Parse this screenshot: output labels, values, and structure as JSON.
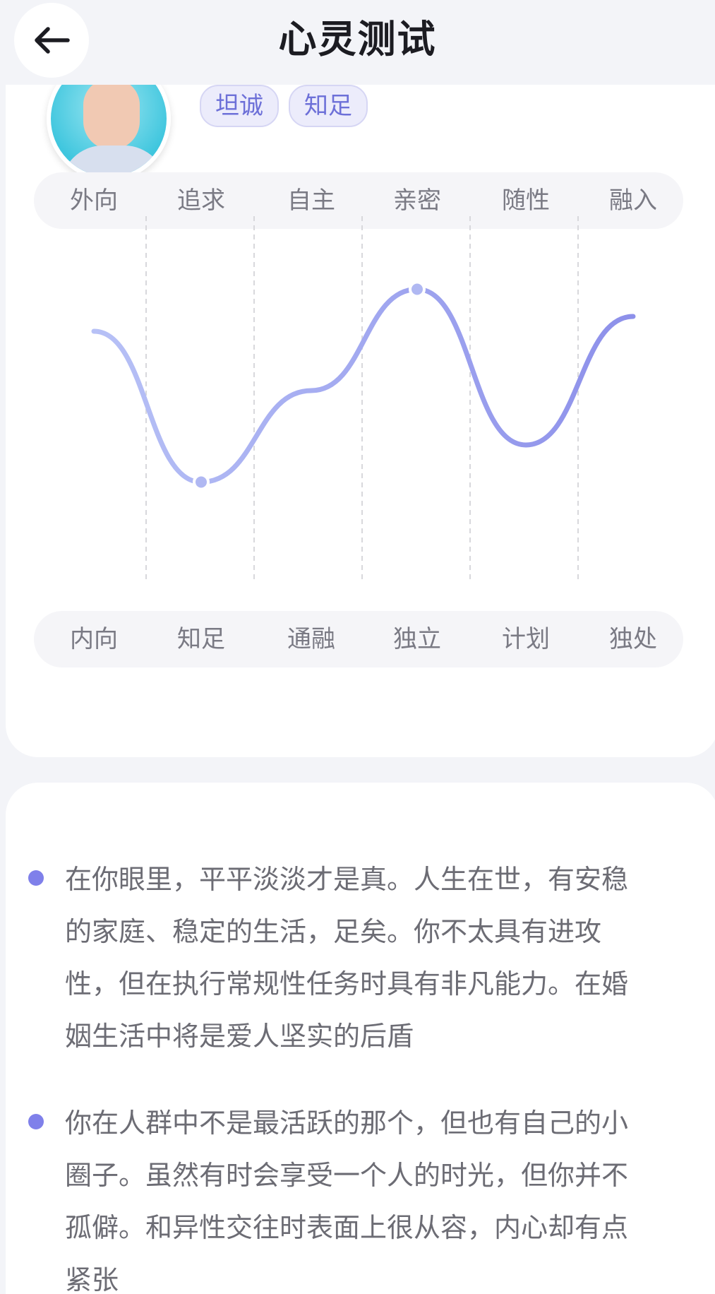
{
  "header": {
    "title": "心灵测试"
  },
  "profile": {
    "tags": [
      "坦诚",
      "知足"
    ]
  },
  "colors": {
    "accent": "#7f80ea",
    "curve_start": "#b7c1f6",
    "curve_end": "#8d90ea",
    "tag_bg": "#ececfb",
    "tag_text": "#6d70d8"
  },
  "chart_data": {
    "type": "line",
    "top_labels": [
      "外向",
      "追求",
      "自主",
      "亲密",
      "随性",
      "融入"
    ],
    "bottom_labels": [
      "内向",
      "知足",
      "通融",
      "独立",
      "计划",
      "独处"
    ],
    "values": [
      0.66,
      0.05,
      0.42,
      0.83,
      0.2,
      0.72
    ],
    "markers": [
      1,
      3
    ],
    "ylim": [
      0,
      1
    ],
    "grid": "vertical-dashed"
  },
  "descriptions": [
    "在你眼里，平平淡淡才是真。人生在世，有安稳的家庭、稳定的生活，足矣。你不太具有进攻性，但在执行常规性任务时具有非凡能力。在婚姻生活中将是爱人坚实的后盾",
    "你在人群中不是最活跃的那个，但也有自己的小圈子。虽然有时会享受一个人的时光，但你并不孤僻。和异性交往时表面上很从容，内心却有点紧张"
  ]
}
